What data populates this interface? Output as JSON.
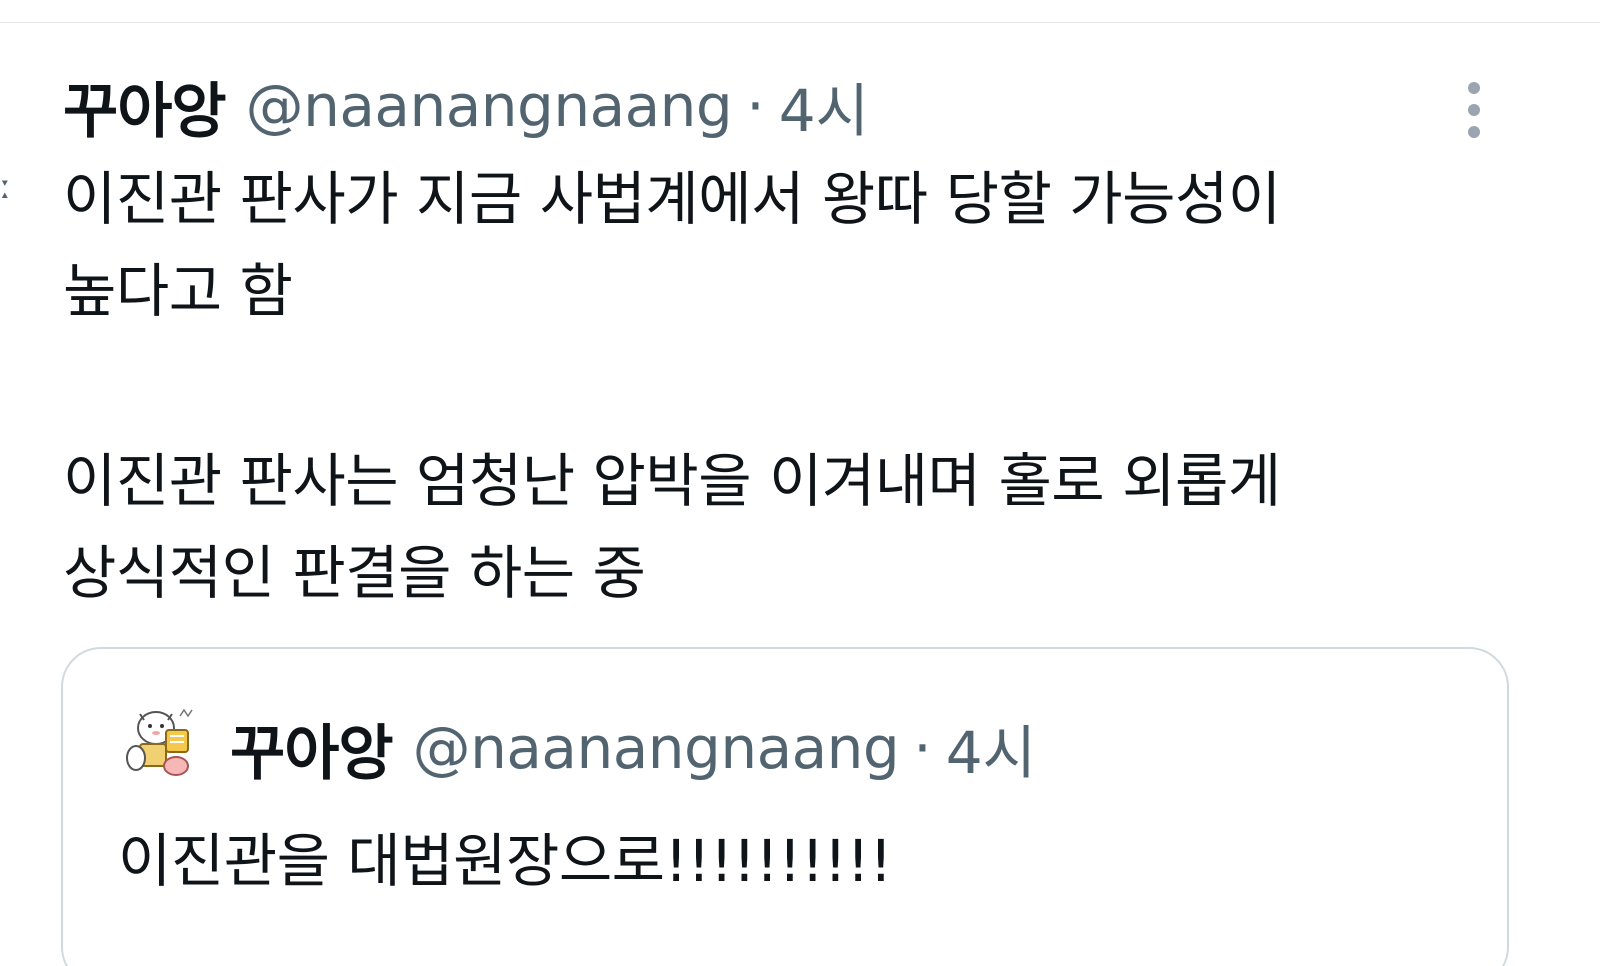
{
  "tweet": {
    "display_name": "꾸아앙",
    "handle": "@naanangnaang",
    "separator": "·",
    "time": "4시",
    "text_lines": [
      "이진관 판사가 지금 사법계에서 왕따 당할 가능성이",
      "높다고 함",
      "이진관 판사는 엄청난 압박을 이겨내며 홀로 외롭게",
      "상식적인 판결을 하는 중"
    ]
  },
  "quoted_tweet": {
    "display_name": "꾸아앙",
    "handle": "@naanangnaang",
    "separator": "·",
    "time": "4시",
    "text": "이진관을 대법원장으로!!!!!!!!!!"
  },
  "colors": {
    "text": "#0f1419",
    "secondary": "#536471",
    "border": "#cfd9de",
    "icon": "#9aa5b1"
  },
  "icons": {
    "more": "more-vertical-icon",
    "avatar": "avatar-image"
  }
}
